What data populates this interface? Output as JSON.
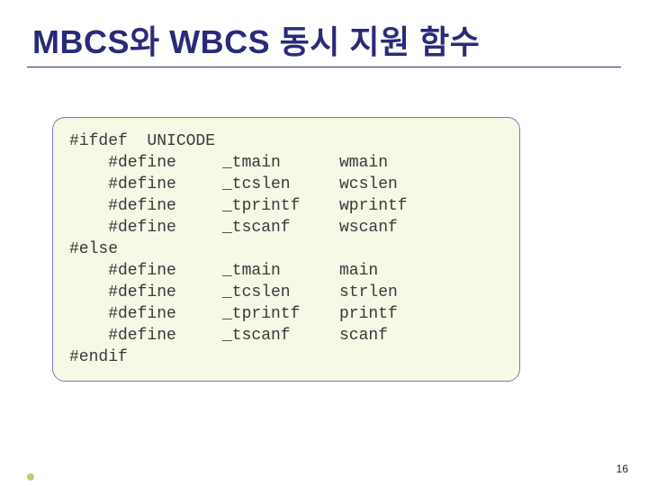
{
  "title": "MBCS와 WBCS 동시 지원 함수",
  "code": {
    "l0": {
      "c1": "#ifdef  UNICODE",
      "c2": "",
      "c3": ""
    },
    "l1": {
      "c1": "    #define",
      "c2": "_tmain",
      "c3": "wmain"
    },
    "l2": {
      "c1": "    #define",
      "c2": "_tcslen",
      "c3": "wcslen"
    },
    "l3": {
      "c1": "    #define",
      "c2": "_tprintf",
      "c3": "wprintf"
    },
    "l4": {
      "c1": "    #define",
      "c2": "_tscanf",
      "c3": "wscanf"
    },
    "l5": {
      "c1": "#else",
      "c2": "",
      "c3": ""
    },
    "l6": {
      "c1": "    #define",
      "c2": "_tmain",
      "c3": "main"
    },
    "l7": {
      "c1": "    #define",
      "c2": "_tcslen",
      "c3": "strlen"
    },
    "l8": {
      "c1": "    #define",
      "c2": "_tprintf",
      "c3": "printf"
    },
    "l9": {
      "c1": "    #define",
      "c2": "_tscanf",
      "c3": "scanf"
    },
    "l10": {
      "c1": "#endif",
      "c2": "",
      "c3": ""
    }
  },
  "page_number": "16"
}
